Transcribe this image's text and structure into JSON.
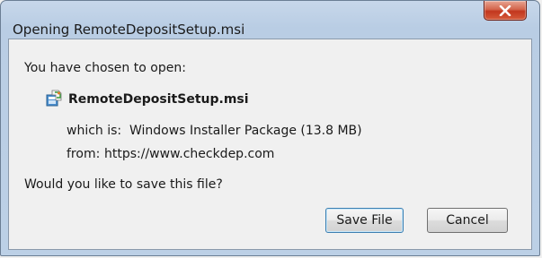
{
  "window": {
    "title": "Opening RemoteDepositSetup.msi"
  },
  "dialog": {
    "intro": "You have chosen to open:",
    "file_name": "RemoteDepositSetup.msi",
    "file_icon": "installer-package-icon",
    "type_label": "which is:",
    "type_value": "Windows Installer Package (13.8 MB)",
    "from_label": "from:",
    "from_value": "https://www.checkdep.com",
    "question": "Would you like to save this file?"
  },
  "buttons": {
    "save_label": "Save File",
    "cancel_label": "Cancel"
  },
  "colors": {
    "close_button": "#c94f34",
    "frame": "#bcd0e6",
    "client_background": "#f0f0f0"
  }
}
